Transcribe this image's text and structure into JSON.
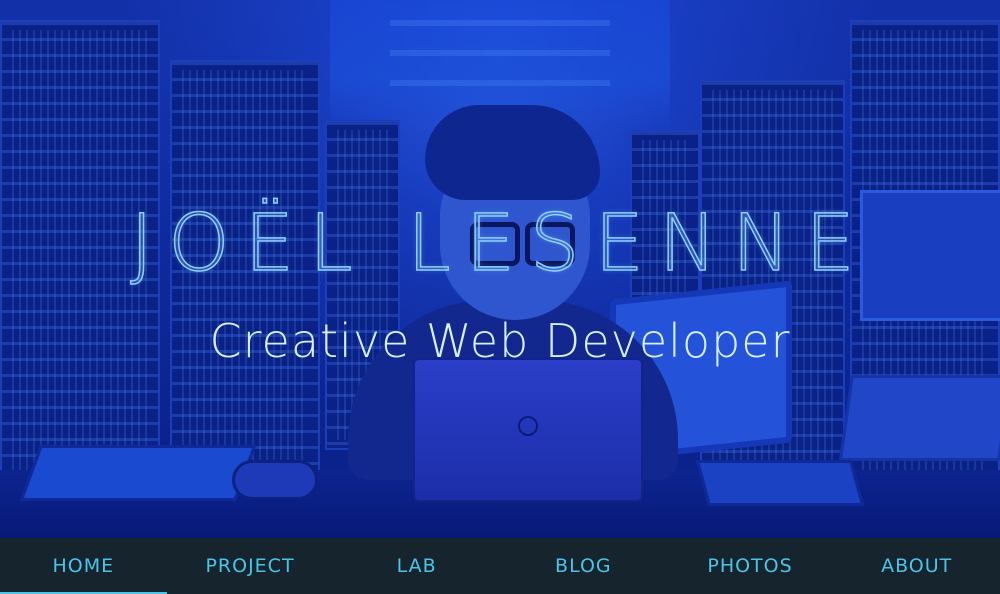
{
  "hero": {
    "title": "JOËL LESENNE",
    "subtitle": "Creative Web Developer"
  },
  "nav": {
    "items": [
      {
        "label": "HOME",
        "active": true
      },
      {
        "label": "PROJECT",
        "active": false
      },
      {
        "label": "LAB",
        "active": false
      },
      {
        "label": "BLOG",
        "active": false
      },
      {
        "label": "PHOTOS",
        "active": false
      },
      {
        "label": "ABOUT",
        "active": false
      }
    ]
  },
  "colors": {
    "nav_background": "#16242e",
    "nav_text": "#4cc4e8",
    "hero_tint": "#0e2a9c",
    "title_outline": "#8fd0ff",
    "subtitle_text": "#d6f0ff"
  },
  "illustration": {
    "description_icon": "developer-at-laptop-in-server-room"
  }
}
